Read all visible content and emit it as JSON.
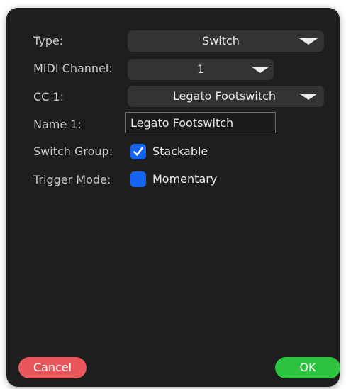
{
  "form": {
    "type": {
      "label": "Type:",
      "value": "Switch"
    },
    "midi_channel": {
      "label": "MIDI Channel:",
      "value": "1"
    },
    "cc1": {
      "label": "CC 1:",
      "value": "Legato Footswitch"
    },
    "name1": {
      "label": "Name 1:",
      "value": "Legato Footswitch"
    },
    "switch_group": {
      "label": "Switch Group:",
      "option_label": "Stackable",
      "checked": true
    },
    "trigger_mode": {
      "label": "Trigger Mode:",
      "option_label": "Momentary",
      "checked": false
    }
  },
  "buttons": {
    "cancel": "Cancel",
    "ok": "OK"
  },
  "colors": {
    "dialog_bg": "#1e1e1e",
    "control_bg": "#333333",
    "accent_blue": "#1466f2",
    "cancel_red": "#e8575c",
    "ok_green": "#2fc440"
  },
  "icons": {
    "dropdown": "chevron-down-icon",
    "check": "checkmark-icon"
  }
}
